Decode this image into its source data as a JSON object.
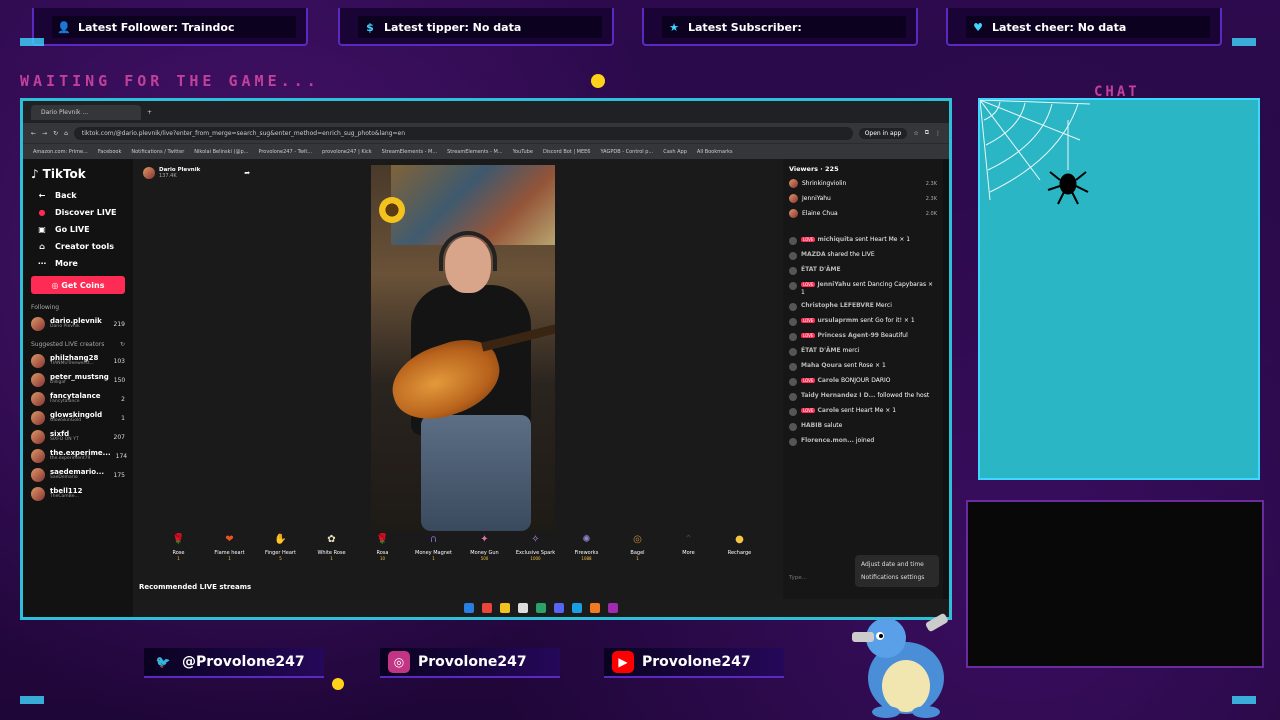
{
  "alerts": [
    {
      "icon": "person-icon",
      "text": "Latest Follower: Traindoc"
    },
    {
      "icon": "dollar-icon",
      "text": "Latest tipper: No data"
    },
    {
      "icon": "star-icon",
      "text": "Latest Subscriber:"
    },
    {
      "icon": "heart-icon",
      "text": "Latest cheer: No data"
    }
  ],
  "overlay": {
    "waiting_text": "WAITING FOR THE GAME...",
    "chat_label": "CHAT"
  },
  "browser": {
    "tab_title": "Dario Plevnik ...",
    "url": "tiktok.com/@dario.plevnik/live?enter_from_merge=search_sug&enter_method=enrich_sug_photo&lang=en",
    "open_app": "Open in app",
    "bookmarks": [
      "Amazon.com: Prime...",
      "Facebook",
      "Notifications / Twitter",
      "Nikolai Belinski (@p...",
      "Provolone247 - Twit...",
      "provolone247 | Kick",
      "StreamElements - M...",
      "StreamElements - M...",
      "YouTube",
      "Discord Bot | MEE6",
      "YAGPDB - Control p...",
      "Cash App",
      "All Bookmarks"
    ]
  },
  "tiktok": {
    "logo": "TikTok",
    "nav": [
      {
        "icon": "back-icon",
        "label": "Back"
      },
      {
        "icon": "discover-live-icon",
        "label": "Discover LIVE"
      },
      {
        "icon": "go-live-icon",
        "label": "Go LIVE"
      },
      {
        "icon": "creator-tools-icon",
        "label": "Creator tools"
      },
      {
        "icon": "more-icon",
        "label": "More"
      }
    ],
    "get_coins": "Get Coins",
    "following_header": "Following",
    "following": [
      {
        "name": "dario.plevnik",
        "sub": "Dario Plevnik",
        "count": "219"
      }
    ],
    "suggested_header": "Suggested LIVE creators",
    "suggested": [
      {
        "name": "philzhang28",
        "sub": "TIANMUTreewerst...",
        "count": "103"
      },
      {
        "name": "peter_mustsng",
        "sub": "Dilligaf",
        "count": "150"
      },
      {
        "name": "fancytalance",
        "sub": "Fancytalance",
        "count": "2"
      },
      {
        "name": "glowskingold",
        "sub": "GlowSkinGold",
        "count": "1"
      },
      {
        "name": "sixfd",
        "sub": "SIXFD ON YT",
        "count": "207"
      },
      {
        "name": "the.experime...",
        "sub": "the.experiment79",
        "count": "174"
      },
      {
        "name": "saedemario...",
        "sub": "SaeDemario",
        "count": "175"
      },
      {
        "name": "tbell112",
        "sub": "TheCamBe...",
        "count": ""
      }
    ],
    "host": {
      "name": "Dario Plevnik",
      "likes": "137.4K"
    },
    "gifts": [
      {
        "name": "Rose",
        "price": "1",
        "glyph": "🌹",
        "color": "#c0304a"
      },
      {
        "name": "Flame heart",
        "price": "1",
        "glyph": "❤",
        "color": "#e8541c"
      },
      {
        "name": "Finger Heart",
        "price": "5",
        "glyph": "✋",
        "color": "#e0a080"
      },
      {
        "name": "White Rose",
        "price": "1",
        "glyph": "✿",
        "color": "#e8e0c0"
      },
      {
        "name": "Rosa",
        "price": "10",
        "glyph": "🌹",
        "color": "#d02040"
      },
      {
        "name": "Money Magnet",
        "price": "1",
        "glyph": "∩",
        "color": "#8a6ad8"
      },
      {
        "name": "Money Gun",
        "price": "500",
        "glyph": "✦",
        "color": "#e070b0"
      },
      {
        "name": "Exclusive Spark",
        "price": "1000",
        "glyph": "✧",
        "color": "#c080e0"
      },
      {
        "name": "Fireworks",
        "price": "1088",
        "glyph": "✺",
        "color": "#9080d0"
      },
      {
        "name": "Bagel",
        "price": "1",
        "glyph": "◎",
        "color": "#c48a3a"
      },
      {
        "name": "More",
        "price": "",
        "glyph": "⌃",
        "color": "#444"
      },
      {
        "name": "Recharge",
        "price": "",
        "glyph": "●",
        "color": "#f6c544"
      }
    ],
    "recommended": "Recommended LIVE streams",
    "viewers_header": "Viewers · 225",
    "viewers": [
      {
        "name": "Shrinkingviolin",
        "count": "2.3K"
      },
      {
        "name": "JenniYahu",
        "count": "2.3K"
      },
      {
        "name": "Elaine Chua",
        "count": "2.0K"
      }
    ],
    "messages": [
      {
        "user": "michiquita",
        "text": "sent Heart Me × 1",
        "badge": "LOVE"
      },
      {
        "user": "MAZDA",
        "text": "shared the LIVE",
        "badge": ""
      },
      {
        "user": "ÉTAT D'ÂME",
        "text": "",
        "badge": ""
      },
      {
        "user": "JenniYahu",
        "text": "sent Dancing Capybaras × 1",
        "badge": "LOVE"
      },
      {
        "user": "Christophe LEFEBVRE",
        "text": "Merci",
        "badge": ""
      },
      {
        "user": "ursulaprmm",
        "text": "sent Go for it! × 1",
        "badge": "LOVE"
      },
      {
        "user": "Princess Agent-99",
        "text": "Beautiful",
        "badge": "LOVE"
      },
      {
        "user": "ÉTAT D'ÂME",
        "text": "merci",
        "badge": ""
      },
      {
        "user": "Maha Qoura",
        "text": "sent Rose × 1",
        "badge": ""
      },
      {
        "user": "Carole",
        "text": "BONJOUR DARIO",
        "badge": "LOVE"
      },
      {
        "user": "Taidy Hernandez I D...",
        "text": "followed the host",
        "badge": ""
      },
      {
        "user": "Carole",
        "text": "sent Heart Me × 1",
        "badge": "LOVE"
      },
      {
        "user": "HABIB",
        "text": "salute",
        "badge": ""
      },
      {
        "user": "Florence.mon...",
        "text": "joined",
        "badge": ""
      }
    ],
    "type_placeholder": "Type...",
    "context_menu": [
      "Adjust date and time",
      "Notifications settings"
    ]
  },
  "socials": [
    {
      "icon": "twitter-icon",
      "handle": "@Provolone247",
      "color": "#1da1f2"
    },
    {
      "icon": "instagram-icon",
      "handle": "Provolone247",
      "color": "#c13584"
    },
    {
      "icon": "youtube-icon",
      "handle": "Provolone247",
      "color": "#ff0000"
    }
  ]
}
